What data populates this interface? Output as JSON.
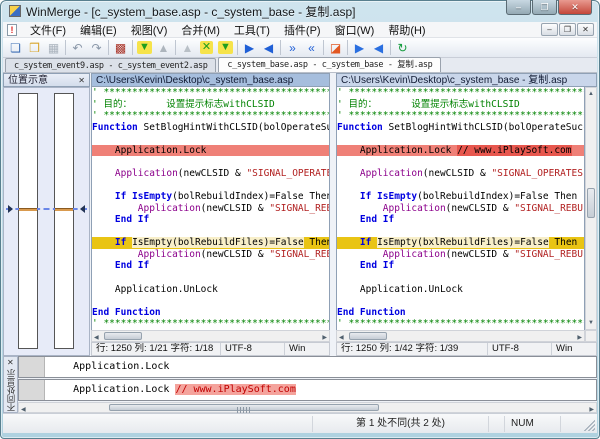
{
  "window": {
    "title": "WinMerge - [c_system_base.asp - c_system_base - 复制.asp]",
    "controls": {
      "minimize": "–",
      "maximize": "❐",
      "close": "✕"
    }
  },
  "menu": {
    "doc_icon_mark": "!",
    "items": [
      "文件(F)",
      "编辑(E)",
      "视图(V)",
      "合并(M)",
      "工具(T)",
      "插件(P)",
      "窗口(W)",
      "帮助(H)"
    ],
    "mdi_controls": [
      {
        "name": "mdi-minimize-icon",
        "glyph": "–"
      },
      {
        "name": "mdi-restore-icon",
        "glyph": "❐"
      },
      {
        "name": "mdi-close-icon",
        "glyph": "✕"
      }
    ]
  },
  "toolbar": {
    "buttons": [
      {
        "name": "new-file-icon",
        "glyph": "❏",
        "color": "#3C6EB4"
      },
      {
        "name": "open-file-icon",
        "glyph": "❒",
        "color": "#D9A62E"
      },
      {
        "name": "save-file-icon",
        "glyph": "▦",
        "color": "#A9B2BC",
        "disabled": true
      },
      {
        "sep": true
      },
      {
        "name": "undo-icon",
        "glyph": "↶",
        "color": "#8A97A8",
        "disabled": true
      },
      {
        "name": "redo-icon",
        "glyph": "↷",
        "color": "#8A97A8",
        "disabled": true
      },
      {
        "sep": true
      },
      {
        "name": "options-icon",
        "glyph": "▩",
        "color": "#A93226"
      },
      {
        "sep": true
      },
      {
        "name": "next-difference-icon",
        "glyph": "▼",
        "color": "#1E9E1E",
        "boxed": true
      },
      {
        "name": "previous-difference-icon",
        "glyph": "▲",
        "color": "#ADB5BD",
        "disabled": true
      },
      {
        "sep": true
      },
      {
        "name": "first-difference-icon",
        "glyph": "▲",
        "color": "#B9C0C7",
        "disabled": true
      },
      {
        "name": "current-difference-icon",
        "glyph": "✕",
        "color": "#1E9E1E",
        "boxed": true
      },
      {
        "name": "last-difference-icon",
        "glyph": "▼",
        "color": "#1E9E1E",
        "boxed": true
      },
      {
        "sep": true
      },
      {
        "name": "copy-right-icon",
        "glyph": "▶",
        "color": "#1F5FD6"
      },
      {
        "name": "copy-left-icon",
        "glyph": "◀",
        "color": "#1F5FD6"
      },
      {
        "sep": true
      },
      {
        "name": "copy-right-advance-icon",
        "glyph": "»",
        "color": "#1F5FD6"
      },
      {
        "name": "copy-left-advance-icon",
        "glyph": "«",
        "color": "#1F5FD6"
      },
      {
        "sep": true
      },
      {
        "name": "auto-merge-icon",
        "glyph": "◪",
        "color": "#E25822"
      },
      {
        "sep": true
      },
      {
        "name": "copy-all-right-icon",
        "glyph": "▶",
        "color": "#2A6FE0"
      },
      {
        "name": "copy-all-left-icon",
        "glyph": "◀",
        "color": "#2A6FE0"
      },
      {
        "sep": true
      },
      {
        "name": "refresh-icon",
        "glyph": "↻",
        "color": "#169C3E"
      }
    ]
  },
  "tabs": [
    {
      "label": "c_system_event9.asp - c_system_event2.asp",
      "active": false
    },
    {
      "label": "c_system_base.asp - c_system_base - 复制.asp",
      "active": true
    }
  ],
  "location_pane": {
    "title": "位置示意",
    "close_glyph": "✕"
  },
  "panes": {
    "left": {
      "path": "C:\\Users\\Kevin\\Desktop\\c_system_base.asp",
      "status_position": "行: 1250 列: 1/21 字符: 1/18",
      "status_encoding": "UTF-8",
      "status_eol": "Win",
      "lines": [
        {
          "s": [
            [
              "cm",
              "' *******************************************************"
            ]
          ]
        },
        {
          "s": [
            [
              "cm",
              "' 目的：      设置提示标志withCLSID"
            ]
          ]
        },
        {
          "s": [
            [
              "cm",
              "' *******************************************************"
            ]
          ]
        },
        {
          "s": [
            [
              "kw",
              "Function "
            ],
            [
              "tx",
              "SetBlogHintWithCLSID(bolOperateSucc"
            ]
          ]
        },
        {},
        {
          "bg": "sel",
          "s": [
            [
              "tx",
              "    Application.Lock"
            ]
          ]
        },
        {},
        {
          "s": [
            [
              "ob",
              "    Application"
            ],
            [
              "tx",
              "(newCLSID & "
            ],
            [
              "st",
              "\"SIGNAL_OPERATES"
            ]
          ]
        },
        {},
        {
          "s": [
            [
              "tx",
              "    "
            ],
            [
              "kw",
              "If IsEmpty"
            ],
            [
              "tx",
              "(bolRebuildIndex)=False Then"
            ]
          ]
        },
        {
          "s": [
            [
              "ob",
              "        Application"
            ],
            [
              "tx",
              "(newCLSID & "
            ],
            [
              "st",
              "\"SIGNAL_REBU"
            ]
          ]
        },
        {
          "s": [
            [
              "kw",
              "    End If"
            ]
          ]
        },
        {},
        {
          "bg": "diff",
          "s": [
            [
              "tx",
              "    "
            ],
            [
              "kw",
              "If"
            ],
            [
              "tx",
              " "
            ],
            [
              "wd",
              "IsEmpty(bolRebuildFiles)=False"
            ],
            [
              "tx",
              " Then"
            ]
          ]
        },
        {
          "s": [
            [
              "ob",
              "        Application"
            ],
            [
              "tx",
              "(newCLSID & "
            ],
            [
              "st",
              "\"SIGNAL_REBU"
            ]
          ]
        },
        {
          "s": [
            [
              "kw",
              "    End If"
            ]
          ]
        },
        {},
        {
          "s": [
            [
              "tx",
              "    Application.UnLock"
            ]
          ]
        },
        {},
        {
          "s": [
            [
              "kw",
              "End Function"
            ]
          ]
        },
        {
          "s": [
            [
              "cm",
              "' *******************************************************"
            ]
          ]
        }
      ]
    },
    "right": {
      "path": "C:\\Users\\Kevin\\Desktop\\c_system_base - 复制.asp",
      "status_position": "行: 1250 列: 1/42 字符: 1/39",
      "status_encoding": "UTF-8",
      "status_eol": "Win",
      "lines": [
        {
          "s": [
            [
              "cm",
              "' *******************************************************"
            ]
          ]
        },
        {
          "s": [
            [
              "cm",
              "' 目的：      设置提示标志withCLSID"
            ]
          ]
        },
        {
          "s": [
            [
              "cm",
              "' *******************************************************"
            ]
          ]
        },
        {
          "s": [
            [
              "kw",
              "Function "
            ],
            [
              "tx",
              "SetBlogHintWithCLSID(bolOperateSucc"
            ]
          ]
        },
        {},
        {
          "bg": "sel",
          "s": [
            [
              "tx",
              "    Application.Lock "
            ],
            [
              "ws",
              "// www.iPlaySoft.com"
            ]
          ]
        },
        {},
        {
          "s": [
            [
              "ob",
              "    Application"
            ],
            [
              "tx",
              "(newCLSID & "
            ],
            [
              "st",
              "\"SIGNAL_OPERATES"
            ]
          ]
        },
        {},
        {
          "s": [
            [
              "tx",
              "    "
            ],
            [
              "kw",
              "If IsEmpty"
            ],
            [
              "tx",
              "(bolRebuildIndex)=False Then"
            ]
          ]
        },
        {
          "s": [
            [
              "ob",
              "        Application"
            ],
            [
              "tx",
              "(newCLSID & "
            ],
            [
              "st",
              "\"SIGNAL_REBU"
            ]
          ]
        },
        {
          "s": [
            [
              "kw",
              "    End If"
            ]
          ]
        },
        {},
        {
          "bg": "diff",
          "s": [
            [
              "tx",
              "    "
            ],
            [
              "kw",
              "If"
            ],
            [
              "tx",
              " "
            ],
            [
              "wd",
              "IsEmpty(bxlRebuildFiles)=False"
            ],
            [
              "tx",
              " Then"
            ]
          ]
        },
        {
          "s": [
            [
              "ob",
              "        Application"
            ],
            [
              "tx",
              "(newCLSID & "
            ],
            [
              "st",
              "\"SIGNAL_REBU"
            ]
          ]
        },
        {
          "s": [
            [
              "kw",
              "    End If"
            ]
          ]
        },
        {},
        {
          "s": [
            [
              "tx",
              "    Application.UnLock"
            ]
          ]
        },
        {},
        {
          "s": [
            [
              "kw",
              "End Function"
            ]
          ]
        },
        {
          "s": [
            [
              "cm",
              "' *******************************************************"
            ]
          ]
        }
      ]
    }
  },
  "diff_pane": {
    "title": "不同处显示",
    "close_glyph": "✕",
    "rows": [
      {
        "s": [
          [
            "tx",
            "    Application.Lock"
          ]
        ]
      },
      {
        "s": [
          [
            "tx",
            "    Application.Lock "
          ],
          [
            "dr",
            "// www.iPlaySoft.com"
          ]
        ]
      }
    ]
  },
  "status_bar": {
    "message": "",
    "diff_status": "第 1 处不同(共 2 处)",
    "num": "NUM"
  },
  "colors": {
    "diff_selected": "#EF8077",
    "diff": "#E9C414",
    "word_diff": "#F8EFC9",
    "word_diff_selected": "#E7574E",
    "comment": "#008200",
    "keyword": "#0000E0",
    "string": "#B22222"
  }
}
